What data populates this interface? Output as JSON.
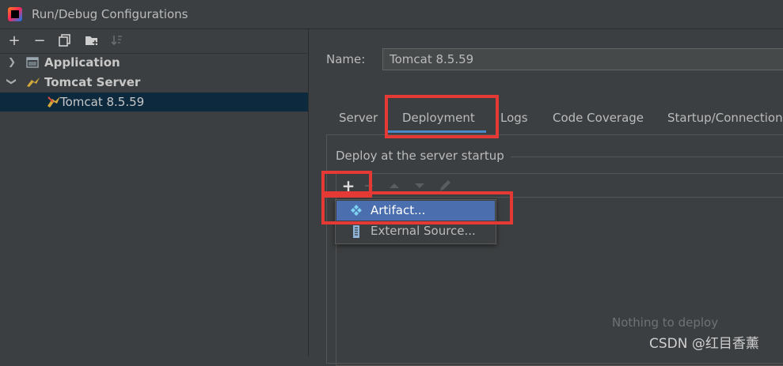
{
  "window": {
    "title": "Run/Debug Configurations"
  },
  "toolbar": {
    "add": "+",
    "remove": "−",
    "copy_icon": "copy-icon",
    "folder_icon": "new-folder-icon",
    "sort_icon": "sort-icon"
  },
  "tree": [
    {
      "label": "Application",
      "icon": "application-icon",
      "expanded": false
    },
    {
      "label": "Tomcat Server",
      "icon": "tomcat-icon",
      "expanded": true
    },
    {
      "label": "Tomcat 8.5.59",
      "icon": "tomcat-icon",
      "selected": true
    }
  ],
  "config": {
    "name_label": "Name:",
    "name_value": "Tomcat 8.5.59"
  },
  "tabs": [
    {
      "label": "Server"
    },
    {
      "label": "Deployment",
      "active": true
    },
    {
      "label": "Logs"
    },
    {
      "label": "Code Coverage"
    },
    {
      "label": "Startup/Connection"
    }
  ],
  "deploy": {
    "section_title": "Deploy at the server startup",
    "add": "+",
    "empty_text": "Nothing to deploy"
  },
  "popup": {
    "items": [
      {
        "label": "Artifact...",
        "icon": "artifact-icon",
        "selected": true
      },
      {
        "label": "External Source...",
        "icon": "external-source-icon"
      }
    ]
  },
  "watermark": "CSDN @红目香薰",
  "colors": {
    "background": "#3c3f41",
    "selection": "#0d293e",
    "popup_selection": "#4b6eaf",
    "tab_underline": "#4a88c7",
    "highlight": "#e53935"
  }
}
